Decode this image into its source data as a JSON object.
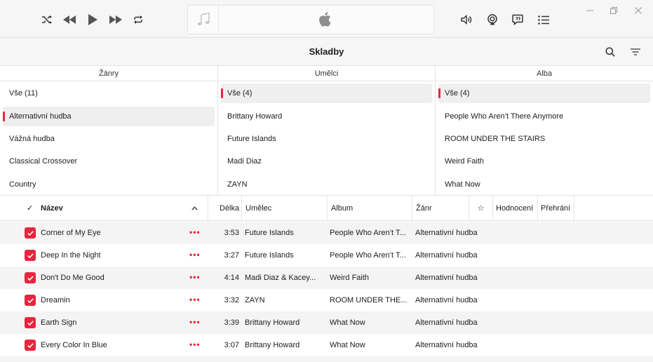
{
  "window": {
    "title": "Skladby"
  },
  "player": {
    "shuffle_icon": "shuffle-icon",
    "previous_icon": "previous-icon",
    "play_icon": "play-icon",
    "next_icon": "next-icon",
    "repeat_icon": "repeat-icon",
    "volume_icon": "volume-icon",
    "airplay_icon": "airplay-icon",
    "lyrics_icon": "lyrics-icon",
    "queue_icon": "queue-icon"
  },
  "browser": {
    "genres": {
      "header": "Žánry",
      "items": [
        "Vše (11)",
        "Alternativní hudba",
        "Vážná hudba",
        "Classical Crossover",
        "Country"
      ],
      "selected": 1
    },
    "artists": {
      "header": "Umělci",
      "items": [
        "Vše (4)",
        "Brittany Howard",
        "Future Islands",
        "Madi Diaz",
        "ZAYN"
      ],
      "selected": 0
    },
    "albums": {
      "header": "Alba",
      "items": [
        "Vše (4)",
        "People Who Aren’t There Anymore",
        "ROOM UNDER THE STAIRS",
        "Weird Faith",
        "What Now"
      ],
      "selected": 0
    }
  },
  "table": {
    "headers": {
      "check": "✓",
      "name": "Název",
      "length": "Délka",
      "artist": "Umělec",
      "album": "Album",
      "genre": "Žánr",
      "love": "☆",
      "rating": "Hodnocení",
      "plays": "Přehrání"
    },
    "more_label": "•••",
    "rows": [
      {
        "name": "Corner of My Eye",
        "length": "3:53",
        "artist": "Future Islands",
        "album": "People Who Aren’t T...",
        "genre": "Alternativní hudba",
        "checked": true
      },
      {
        "name": "Deep In the Night",
        "length": "3:27",
        "artist": "Future Islands",
        "album": "People Who Aren’t T...",
        "genre": "Alternativní hudba",
        "checked": true
      },
      {
        "name": "Don't Do Me Good",
        "length": "4:14",
        "artist": "Madi Diaz & Kacey...",
        "album": "Weird Faith",
        "genre": "Alternativní hudba",
        "checked": true
      },
      {
        "name": "Dreamin",
        "length": "3:32",
        "artist": "ZAYN",
        "album": "ROOM UNDER THE...",
        "genre": "Alternativní hudba",
        "checked": true
      },
      {
        "name": "Earth Sign",
        "length": "3:39",
        "artist": "Brittany Howard",
        "album": "What Now",
        "genre": "Alternativní hudba",
        "checked": true
      },
      {
        "name": "Every Color In Blue",
        "length": "3:07",
        "artist": "Brittany Howard",
        "album": "What Now",
        "genre": "Alternativní hudba",
        "checked": true
      }
    ]
  },
  "colors": {
    "accent": "#e8253d",
    "row_alt": "#f4f4f4",
    "bar_bg": "#f6f6f6"
  }
}
